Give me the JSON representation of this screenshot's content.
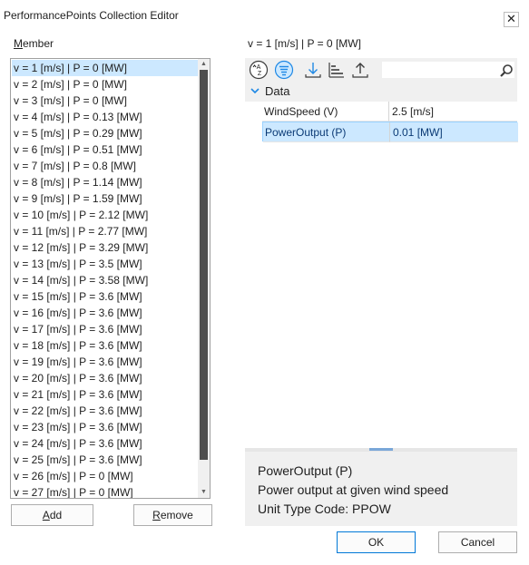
{
  "window": {
    "title": "PerformancePoints Collection Editor",
    "close_glyph": "✕"
  },
  "members": {
    "label_hotkey": "M",
    "label_rest": "ember",
    "items": [
      "v = 1 [m/s] | P = 0 [MW]",
      "v = 2 [m/s] | P = 0 [MW]",
      "v = 3 [m/s] | P = 0 [MW]",
      "v = 4 [m/s] | P = 0.13 [MW]",
      "v = 5 [m/s] | P = 0.29 [MW]",
      "v = 6 [m/s] | P = 0.51 [MW]",
      "v = 7 [m/s] | P = 0.8 [MW]",
      "v = 8 [m/s] | P = 1.14 [MW]",
      "v = 9 [m/s] | P = 1.59 [MW]",
      "v = 10 [m/s] | P = 2.12 [MW]",
      "v = 11 [m/s] | P = 2.77 [MW]",
      "v = 12 [m/s] | P = 3.29 [MW]",
      "v = 13 [m/s] | P = 3.5 [MW]",
      "v = 14 [m/s] | P = 3.58 [MW]",
      "v = 15 [m/s] | P = 3.6 [MW]",
      "v = 16 [m/s] | P = 3.6 [MW]",
      "v = 17 [m/s] | P = 3.6 [MW]",
      "v = 18 [m/s] | P = 3.6 [MW]",
      "v = 19 [m/s] | P = 3.6 [MW]",
      "v = 20 [m/s] | P = 3.6 [MW]",
      "v = 21 [m/s] | P = 3.6 [MW]",
      "v = 22 [m/s] | P = 3.6 [MW]",
      "v = 23 [m/s] | P = 3.6 [MW]",
      "v = 24 [m/s] | P = 3.6 [MW]",
      "v = 25 [m/s] | P = 3.6 [MW]",
      "v = 26 [m/s] | P = 0 [MW]",
      "v = 27 [m/s] | P = 0 [MW]"
    ],
    "selected_index": 0
  },
  "buttons": {
    "add_hotkey": "A",
    "add_rest": "dd",
    "remove_hotkey": "R",
    "remove_rest": "emove",
    "ok": "OK",
    "cancel": "Cancel"
  },
  "properties": {
    "selected_caption": "v = 1 [m/s] | P = 0 [MW]",
    "toolbar_icons": [
      "sort-alphabetical-icon",
      "categorized-icon",
      "download-icon",
      "bar-sort-icon",
      "upload-icon"
    ],
    "search": {
      "value": "",
      "placeholder": ""
    },
    "category": "Data",
    "rows": [
      {
        "name": "WindSpeed (V)",
        "value": "2.5 [m/s]",
        "selected": false
      },
      {
        "name": "PowerOutput (P)",
        "value": "0.01 [MW]",
        "selected": true
      }
    ],
    "description": {
      "name": "PowerOutput (P)",
      "text": "Power output at given wind speed",
      "unit": "Unit Type Code: PPOW"
    }
  },
  "colors": {
    "selection": "#cce8ff",
    "accent": "#1e88e5"
  }
}
